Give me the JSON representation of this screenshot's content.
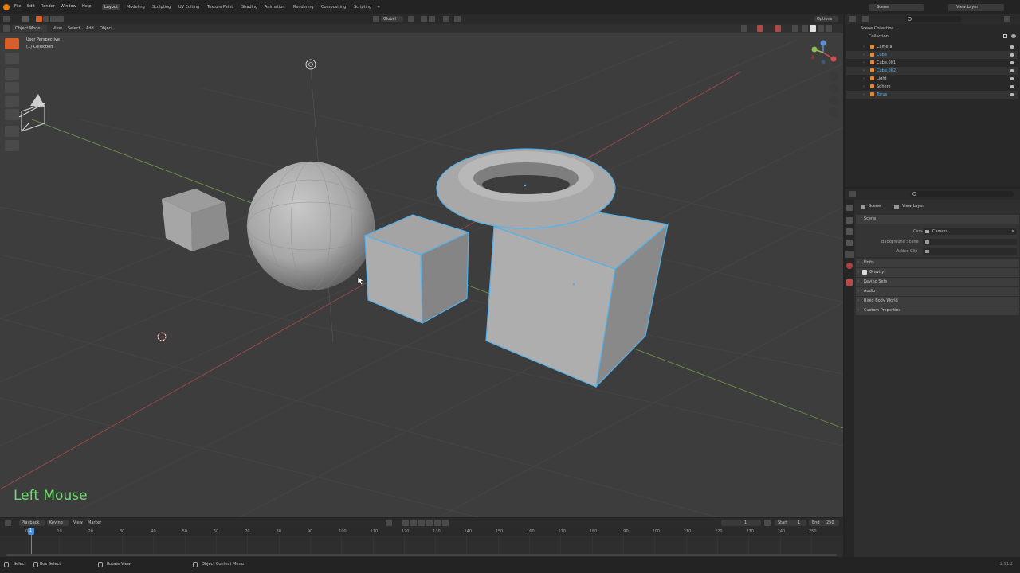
{
  "topbar": {
    "menus": [
      "File",
      "Edit",
      "Render",
      "Window",
      "Help"
    ],
    "workspaces": [
      "Layout",
      "Modeling",
      "Sculpting",
      "UV Editing",
      "Texture Paint",
      "Shading",
      "Animation",
      "Rendering",
      "Compositing",
      "Scripting"
    ],
    "active_workspace": "Layout",
    "add_workspace": "+",
    "scene": "Scene",
    "view_layer": "View Layer"
  },
  "viewport_header": {
    "mode": "Object Mode",
    "menus": [
      "View",
      "Select",
      "Add",
      "Object"
    ],
    "transform_orientation": "Global",
    "options": "Options"
  },
  "viewport": {
    "perspective_label": "User Perspective",
    "collection_label": "(1) Collection",
    "key_overlay": "Left Mouse",
    "colors": {
      "background": "#3d3d3d",
      "grid": "#474747",
      "x_axis": "#a84b4b",
      "y_axis": "#6f9a4a",
      "selection": "#4fb3ef",
      "mesh": "#b4b4b4"
    }
  },
  "outliner": {
    "root": "Scene Collection",
    "collection": "Collection",
    "items": [
      {
        "name": "Camera",
        "selected": false,
        "color": "#c9c9c9"
      },
      {
        "name": "Cube",
        "selected": true,
        "color": "#55b3f0"
      },
      {
        "name": "Cube.001",
        "selected": false,
        "color": "#c9c9c9"
      },
      {
        "name": "Cube.002",
        "selected": true,
        "color": "#55b3f0"
      },
      {
        "name": "Light",
        "selected": false,
        "color": "#c9c9c9"
      },
      {
        "name": "Sphere",
        "selected": false,
        "color": "#c9c9c9"
      },
      {
        "name": "Torus",
        "selected": true,
        "color": "#55b3f0"
      }
    ]
  },
  "properties": {
    "breadcrumb_scene": "Scene",
    "breadcrumb_layer": "View Layer",
    "panel_title": "Scene",
    "fields": [
      {
        "label": "Camera",
        "value": "Camera"
      },
      {
        "label": "Background Scene",
        "value": ""
      },
      {
        "label": "Active Clip",
        "value": ""
      }
    ],
    "subpanels": [
      "Units",
      "Gravity",
      "Keying Sets",
      "Audio",
      "Rigid Body World",
      "Custom Properties"
    ]
  },
  "timeline": {
    "menus": [
      "Playback",
      "Keying",
      "View",
      "Marker"
    ],
    "current_frame": "1",
    "start_label": "Start",
    "start": "1",
    "end_label": "End",
    "end": "250",
    "ticks": [
      "0",
      "10",
      "20",
      "30",
      "40",
      "50",
      "60",
      "70",
      "80",
      "90",
      "100",
      "110",
      "120",
      "130",
      "140",
      "150",
      "160",
      "170",
      "180",
      "190",
      "200",
      "210",
      "220",
      "230",
      "240",
      "250"
    ],
    "playhead": "1"
  },
  "statusbar": {
    "items": [
      "Select",
      "Box Select",
      "Rotate View",
      "Object Context Menu"
    ],
    "version": "2.91.2"
  }
}
